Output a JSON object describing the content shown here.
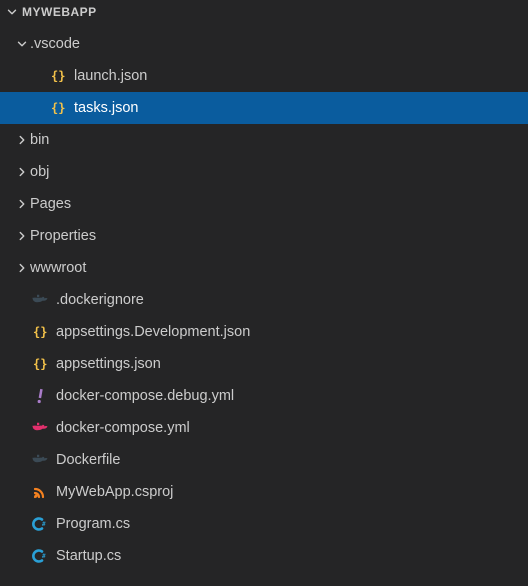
{
  "header": {
    "title": "MYWEBAPP"
  },
  "tree": [
    {
      "kind": "folder",
      "name": ".vscode",
      "depth": 1,
      "expanded": true,
      "selected": false
    },
    {
      "kind": "file",
      "name": "launch.json",
      "depth": 2,
      "icon": "json",
      "selected": false
    },
    {
      "kind": "file",
      "name": "tasks.json",
      "depth": 2,
      "icon": "json",
      "selected": true
    },
    {
      "kind": "folder",
      "name": "bin",
      "depth": 1,
      "expanded": false,
      "selected": false
    },
    {
      "kind": "folder",
      "name": "obj",
      "depth": 1,
      "expanded": false,
      "selected": false
    },
    {
      "kind": "folder",
      "name": "Pages",
      "depth": 1,
      "expanded": false,
      "selected": false
    },
    {
      "kind": "folder",
      "name": "Properties",
      "depth": 1,
      "expanded": false,
      "selected": false
    },
    {
      "kind": "folder",
      "name": "wwwroot",
      "depth": 1,
      "expanded": false,
      "selected": false
    },
    {
      "kind": "file",
      "name": ".dockerignore",
      "depth": 1,
      "icon": "docker-dim",
      "selected": false
    },
    {
      "kind": "file",
      "name": "appsettings.Development.json",
      "depth": 1,
      "icon": "json",
      "selected": false
    },
    {
      "kind": "file",
      "name": "appsettings.json",
      "depth": 1,
      "icon": "json",
      "selected": false
    },
    {
      "kind": "file",
      "name": "docker-compose.debug.yml",
      "depth": 1,
      "icon": "excl",
      "selected": false
    },
    {
      "kind": "file",
      "name": "docker-compose.yml",
      "depth": 1,
      "icon": "docker",
      "selected": false
    },
    {
      "kind": "file",
      "name": "Dockerfile",
      "depth": 1,
      "icon": "docker-dim",
      "selected": false
    },
    {
      "kind": "file",
      "name": "MyWebApp.csproj",
      "depth": 1,
      "icon": "rss",
      "selected": false
    },
    {
      "kind": "file",
      "name": "Program.cs",
      "depth": 1,
      "icon": "cs",
      "selected": false
    },
    {
      "kind": "file",
      "name": "Startup.cs",
      "depth": 1,
      "icon": "cs",
      "selected": false
    }
  ],
  "indent": {
    "base": 14,
    "step": 18
  }
}
